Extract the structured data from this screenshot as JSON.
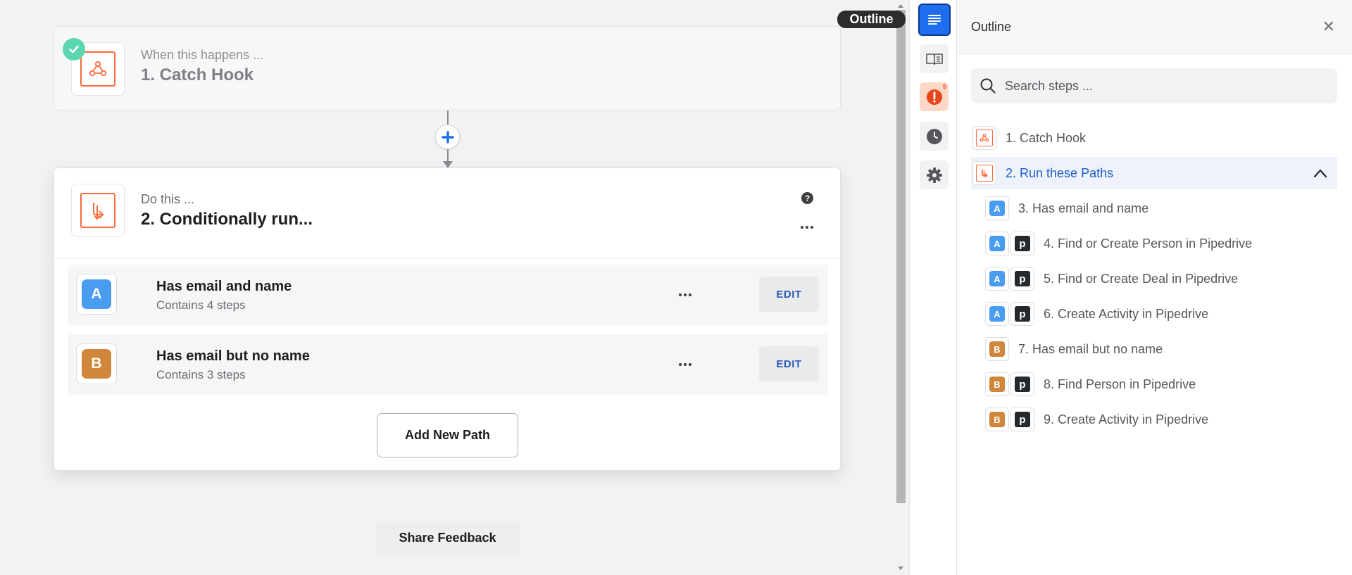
{
  "canvas": {
    "tooltip": "Outline",
    "trigger": {
      "subtitle": "When this happens ...",
      "title": "1. Catch Hook"
    },
    "action": {
      "subtitle": "Do this ...",
      "title": "2. Conditionally run...",
      "help_glyph": "?",
      "paths": [
        {
          "letter": "A",
          "name": "Has email and name",
          "steps": "Contains 4 steps",
          "edit_label": "EDIT",
          "color": "#4a9cf0"
        },
        {
          "letter": "B",
          "name": "Has email but no name",
          "steps": "Contains 3 steps",
          "edit_label": "EDIT",
          "color": "#d1873b"
        }
      ],
      "add_path_label": "Add New Path"
    },
    "share_feedback_label": "Share Feedback"
  },
  "rail": {
    "alert_count": "5",
    "items": [
      "outline-icon",
      "book-icon",
      "alert-icon",
      "clock-icon",
      "gear-icon"
    ]
  },
  "outline_panel": {
    "title": "Outline",
    "close_glyph": "✕",
    "search_placeholder": "Search steps ...",
    "items": [
      {
        "label": "1. Catch Hook",
        "icons": [
          "webhook"
        ]
      },
      {
        "label": "2. Run these Paths",
        "icons": [
          "paths"
        ],
        "selected": true
      },
      {
        "label": "3. Has email and name",
        "icons": [
          "A"
        ]
      },
      {
        "label": "4. Find or Create Person in Pipedrive",
        "icons": [
          "A",
          "p"
        ]
      },
      {
        "label": "5. Find or Create Deal in Pipedrive",
        "icons": [
          "A",
          "p"
        ]
      },
      {
        "label": "6. Create Activity in Pipedrive",
        "icons": [
          "A",
          "p"
        ]
      },
      {
        "label": "7. Has email but no name",
        "icons": [
          "B"
        ]
      },
      {
        "label": "8. Find Person in Pipedrive",
        "icons": [
          "B",
          "p"
        ]
      },
      {
        "label": "9. Create Activity in Pipedrive",
        "icons": [
          "B",
          "p"
        ]
      }
    ],
    "pipedrive_letter": "p"
  },
  "colors": {
    "accent": "#1f6ef0",
    "zapier_orange": "#ff6a3d",
    "path_a": "#4a9cf0",
    "path_b": "#d1873b",
    "success": "#5cd6b0"
  }
}
